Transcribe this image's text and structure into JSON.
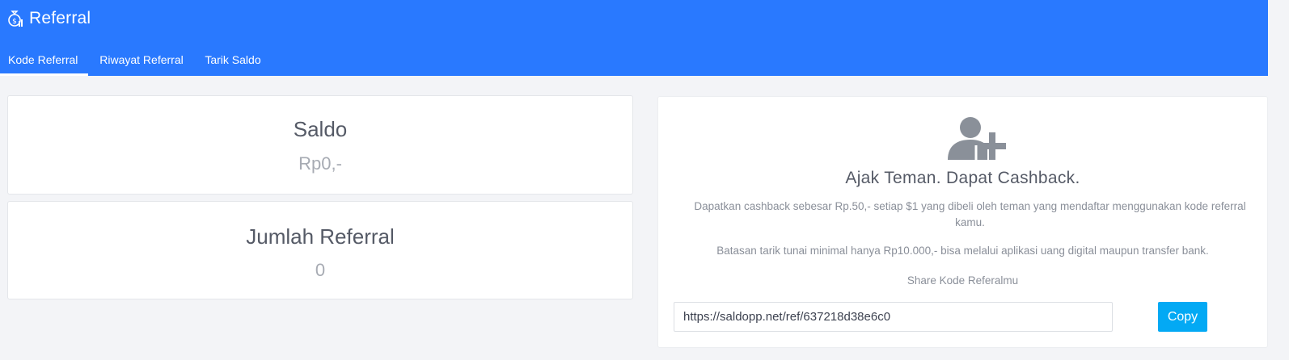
{
  "header": {
    "title": "Referral",
    "icon": "money-bag-icon"
  },
  "tabs": [
    {
      "label": "Kode Referral",
      "active": true
    },
    {
      "label": "Riwayat Referral",
      "active": false
    },
    {
      "label": "Tarik Saldo",
      "active": false
    }
  ],
  "saldo": {
    "label": "Saldo",
    "value": "Rp0,-"
  },
  "referral_count": {
    "label": "Jumlah Referral",
    "value": "0"
  },
  "invite": {
    "icon": "add-user-icon",
    "title": "Ajak Teman. Dapat Cashback.",
    "description": "Dapatkan cashback sebesar Rp.50,- setiap $1 yang dibeli oleh teman yang mendaftar menggunakan kode referral kamu.",
    "limit_note": "Batasan tarik tunai minimal hanya Rp10.000,- bisa melalui aplikasi uang digital maupun transfer bank.",
    "share_label": "Share Kode Referalmu",
    "link_value": "https://saldopp.net/ref/637218d38e6c0",
    "copy_label": "Copy"
  },
  "colors": {
    "header_bg": "#2979ff",
    "copy_button": "#03a9f4",
    "page_bg": "#f3f4f7"
  }
}
